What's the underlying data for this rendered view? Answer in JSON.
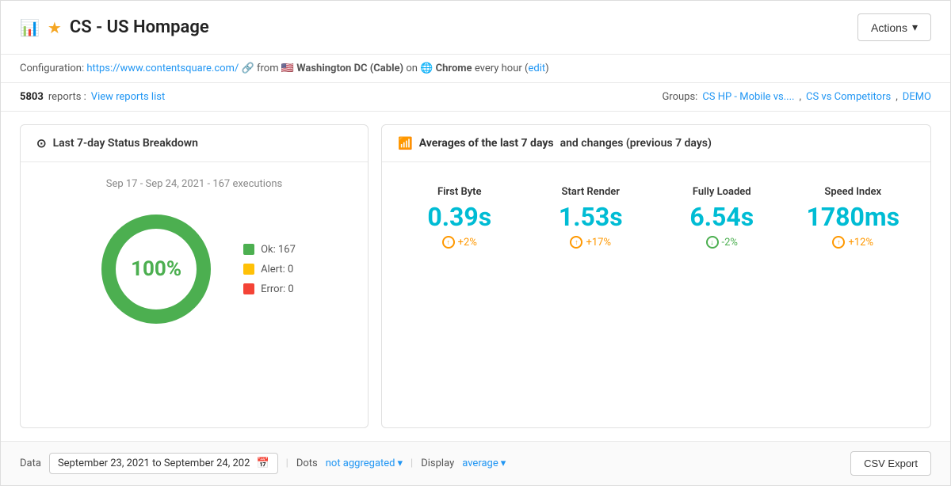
{
  "header": {
    "title": "CS - US Hompage",
    "actions_label": "Actions"
  },
  "config": {
    "label": "Configuration:",
    "url": "https://www.contentsquare.com/",
    "location": "Washington DC (Cable)",
    "browser": "Chrome",
    "frequency": "every hour",
    "edit_label": "edit"
  },
  "reports": {
    "count": "5803",
    "count_suffix": "reports :",
    "view_list_label": "View reports list",
    "groups_label": "Groups:",
    "groups": [
      {
        "name": "CS HP - Mobile vs...."
      },
      {
        "name": "CS vs Competitors"
      },
      {
        "name": "DEMO"
      }
    ]
  },
  "status_card": {
    "header": "Last 7-day Status Breakdown",
    "date_range": "Sep 17 - Sep 24, 2021 - 167 executions",
    "percentage": "100%",
    "legend": [
      {
        "label": "Ok: 167",
        "color": "#4CAF50"
      },
      {
        "label": "Alert: 0",
        "color": "#FFC107"
      },
      {
        "label": "Error: 0",
        "color": "#F44336"
      }
    ]
  },
  "averages_card": {
    "header_prefix": "Averages of the last 7 days",
    "header_suffix": "and changes (previous 7 days)",
    "metrics": [
      {
        "label": "First Byte",
        "value": "0.39s",
        "change": "+2%",
        "change_type": "positive"
      },
      {
        "label": "Start Render",
        "value": "1.53s",
        "change": "+17%",
        "change_type": "positive"
      },
      {
        "label": "Fully Loaded",
        "value": "6.54s",
        "change": "-2%",
        "change_type": "negative"
      },
      {
        "label": "Speed Index",
        "value": "1780ms",
        "change": "+12%",
        "change_type": "positive"
      }
    ]
  },
  "bottom_bar": {
    "data_label": "Data",
    "date_range": "September 23, 2021 to September 24, 202",
    "dots_label": "Dots",
    "dots_value": "not aggregated",
    "display_label": "Display",
    "display_value": "average",
    "csv_label": "CSV Export"
  }
}
